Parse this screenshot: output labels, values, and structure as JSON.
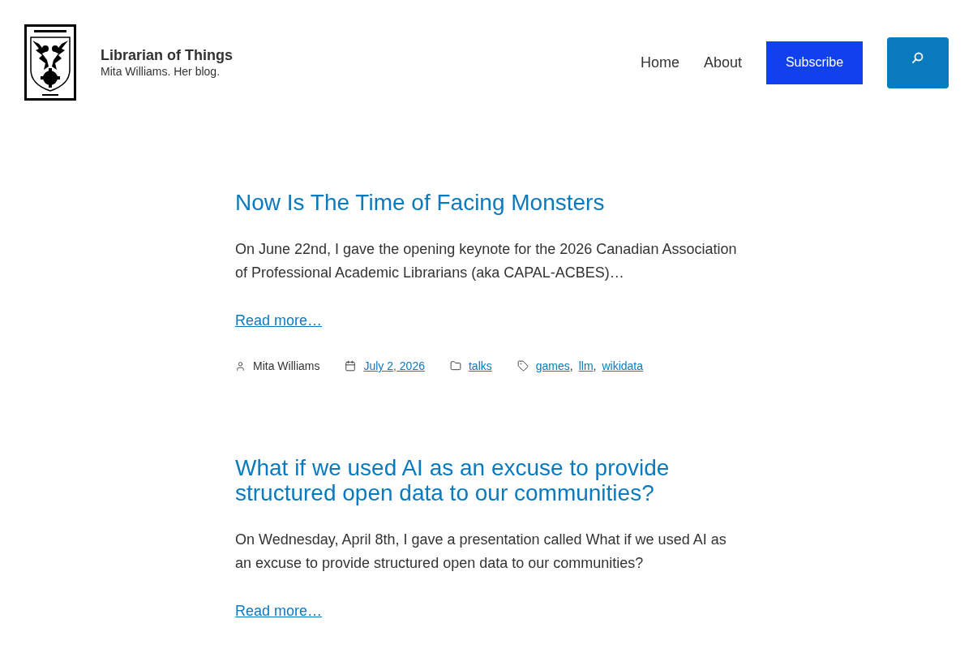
{
  "header": {
    "site_title": "Librarian of Things",
    "tagline": "Mita Williams. Her blog.",
    "nav": [
      {
        "label": "Home"
      },
      {
        "label": "About"
      }
    ],
    "subscribe_button": "Subscribe"
  },
  "posts": [
    {
      "title": "Now Is The Time of Facing Monsters",
      "excerpt": "On June 22nd, I gave the opening keynote for the 2026 Canadian Association of Professional Academic Librarians (aka CAPAL-ACBES)…",
      "read_more": "Read more…",
      "meta": {
        "author": "Mita Williams",
        "date": "July 2, 2026",
        "categories": [
          "talks"
        ],
        "tags": [
          {
            "label": "games",
            "separator": ","
          },
          {
            "label": "llm",
            "separator": ","
          },
          {
            "label": "wikidata"
          }
        ]
      }
    },
    {
      "title": "What if we used AI as an excuse to provide structured open data to our communities?",
      "excerpt": "On Wednesday, April 8th, I gave a presentation called What if we used AI as an excuse to provide structured open data to our communities?",
      "read_more": "Read more…"
    }
  ]
}
